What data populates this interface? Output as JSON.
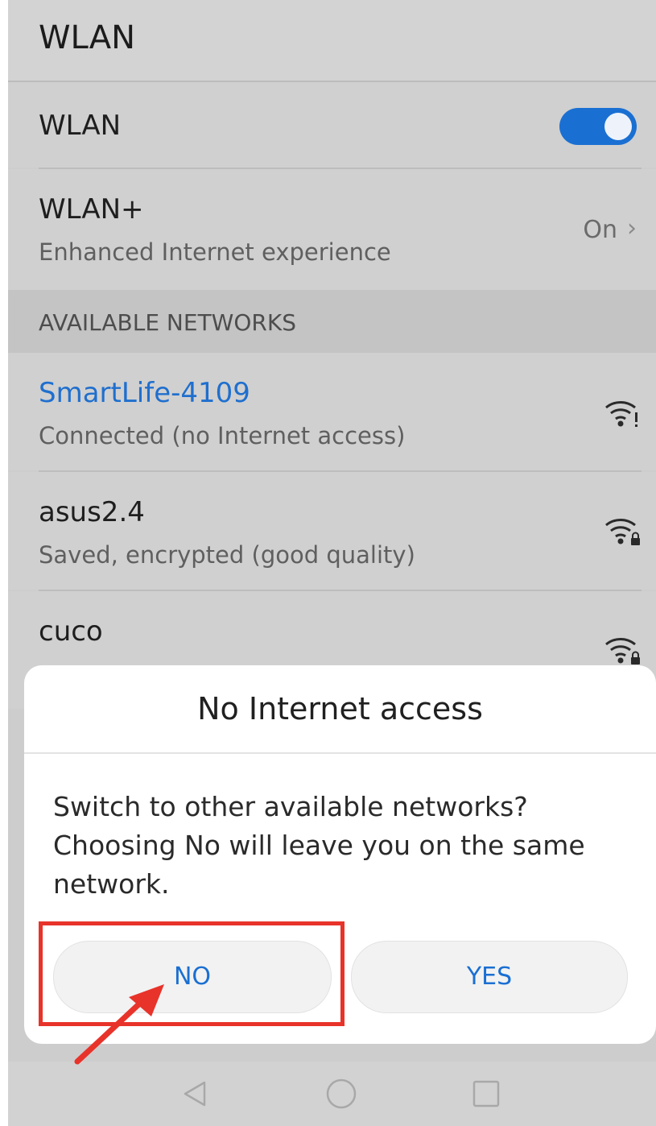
{
  "header": {
    "title": "WLAN"
  },
  "wlan_toggle": {
    "label": "WLAN",
    "state": "on"
  },
  "wlan_plus": {
    "label": "WLAN+",
    "subtitle": "Enhanced Internet experience",
    "value": "On"
  },
  "section": {
    "label": "AVAILABLE NETWORKS"
  },
  "networks": [
    {
      "name": "SmartLife-4109",
      "status": "Connected (no Internet access)",
      "icon": "wifi-warning-icon"
    },
    {
      "name": "asus2.4",
      "status": "Saved, encrypted (good quality)",
      "icon": "wifi-lock-icon"
    },
    {
      "name": "cuco",
      "icon": "wifi-lock-icon"
    }
  ],
  "dialog": {
    "title": "No Internet access",
    "message": "Switch to other available networks? Choosing No will leave you on the same network.",
    "buttons": {
      "no": "NO",
      "yes": "YES"
    }
  },
  "nav": {
    "back": "back-icon",
    "home": "home-icon",
    "recents": "recents-icon"
  },
  "colors": {
    "accent": "#1a6fd2",
    "highlight": "#e8332a"
  }
}
